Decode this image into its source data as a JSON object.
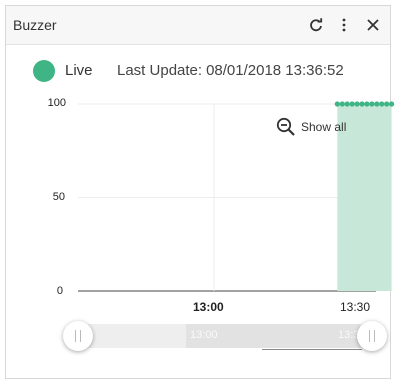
{
  "widget": {
    "title": "Buzzer",
    "icons": [
      "refresh-icon",
      "more-vertical-icon",
      "close-icon"
    ]
  },
  "status": {
    "label": "Live",
    "color": "#3fb484",
    "last_update_prefix": "Last Update:",
    "last_update_value": "08/01/2018 13:36:52"
  },
  "zoom": {
    "label": "Show all",
    "icon": "zoom-out-icon"
  },
  "slider": {
    "range_start_label": "13:00",
    "range_end_label": "13:3"
  },
  "colors": {
    "accent": "#3fb484",
    "area_fill": "#c7e7d9",
    "marker": "#3fb484"
  },
  "chart_data": {
    "type": "area",
    "y_ticks": [
      "100",
      "50",
      "0"
    ],
    "ylim": [
      0,
      100
    ],
    "x_ticks": [
      "13:00",
      "13:30"
    ],
    "grid": true,
    "series": [
      {
        "x": [
          "13:25",
          "13:26",
          "13:27",
          "13:28",
          "13:29",
          "13:30",
          "13:31",
          "13:32",
          "13:33",
          "13:34",
          "13:35",
          "13:36"
        ],
        "values": [
          100,
          100,
          100,
          100,
          100,
          100,
          100,
          100,
          100,
          100,
          100,
          100
        ]
      }
    ]
  }
}
